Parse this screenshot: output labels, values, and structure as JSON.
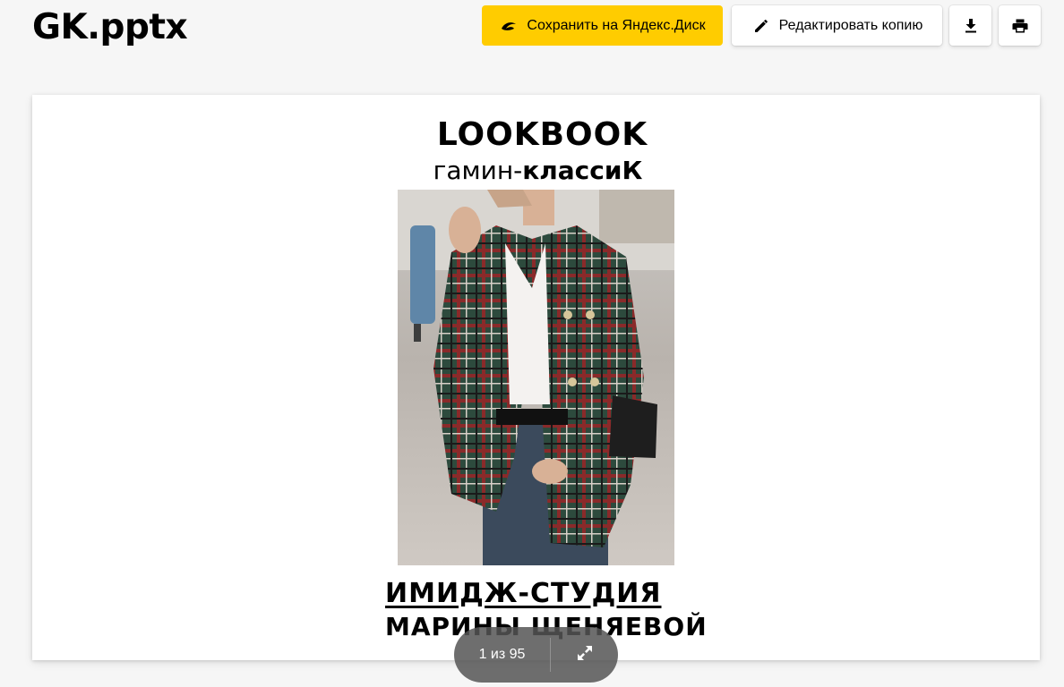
{
  "document": {
    "title": "GK.pptx"
  },
  "toolbar": {
    "save_label": "Сохранить на Яндекс.Диск",
    "edit_label": "Редактировать копию",
    "download_icon": "download-icon",
    "print_icon": "print-icon"
  },
  "slide": {
    "heading": "LOOKBOOK",
    "subheading_light": "гамин-",
    "subheading_bold": "классиК",
    "studio_line1": "ИМИДЖ-СТУДИЯ",
    "studio_line2": "МАРИНЫ ЩЕНЯЕВОЙ"
  },
  "pager": {
    "label": "1 из 95",
    "current_page": 1,
    "total_pages": 95
  },
  "colors": {
    "accent": "#ffcc00",
    "background": "#f6f6f6",
    "pager_bg": "#555555"
  }
}
